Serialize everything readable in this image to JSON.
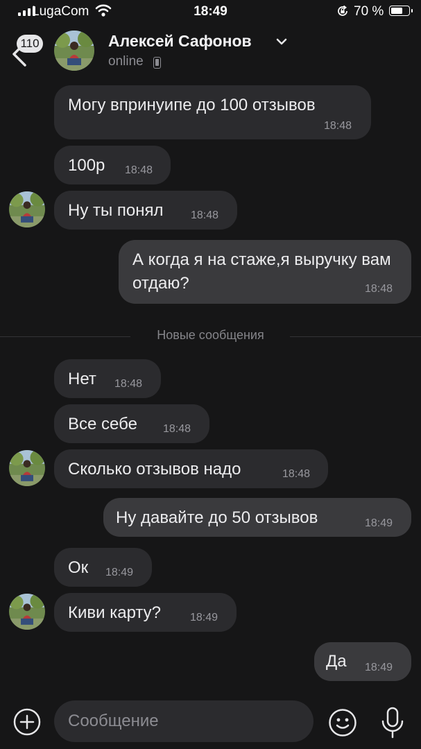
{
  "status_bar": {
    "carrier": "LugaCom",
    "time": "18:49",
    "battery": "70 %",
    "battery_level": 0.7
  },
  "header": {
    "unread_badge": "110",
    "contact_name": "Алексей Сафонов",
    "presence": "online"
  },
  "messages": [
    {
      "text": "Могу впринуипе до 100 отзывов",
      "time": "18:48",
      "direction": "incoming"
    },
    {
      "text": "100р",
      "time": "18:48",
      "direction": "incoming"
    },
    {
      "text": "Ну ты понял",
      "time": "18:48",
      "direction": "incoming"
    },
    {
      "text": "А когда я на стаже,я выручку вам отдаю?",
      "time": "18:48",
      "direction": "outgoing"
    },
    {
      "text": "Нет",
      "time": "18:48",
      "direction": "incoming"
    },
    {
      "text": "Все себе",
      "time": "18:48",
      "direction": "incoming"
    },
    {
      "text": "Сколько отзывов надо",
      "time": "18:48",
      "direction": "incoming"
    },
    {
      "text": "Ну давайте до 50 отзывов",
      "time": "18:49",
      "direction": "outgoing"
    },
    {
      "text": "Ок",
      "time": "18:49",
      "direction": "incoming"
    },
    {
      "text": "Киви карту?",
      "time": "18:49",
      "direction": "incoming"
    },
    {
      "text": "Да",
      "time": "18:49",
      "direction": "outgoing"
    }
  ],
  "new_messages_divider": "Новые сообщения",
  "composer": {
    "placeholder": "Сообщение"
  },
  "colors": {
    "background": "#161617",
    "incoming_bubble": "#2b2b2e",
    "outgoing_bubble": "#3a3a3d"
  },
  "icons": [
    "back-chevron-icon",
    "chevron-down-icon",
    "phone-icon",
    "plus-circle-icon",
    "emoji-icon",
    "microphone-icon",
    "signal-icon",
    "wifi-icon",
    "rotation-lock-icon",
    "battery-icon"
  ]
}
